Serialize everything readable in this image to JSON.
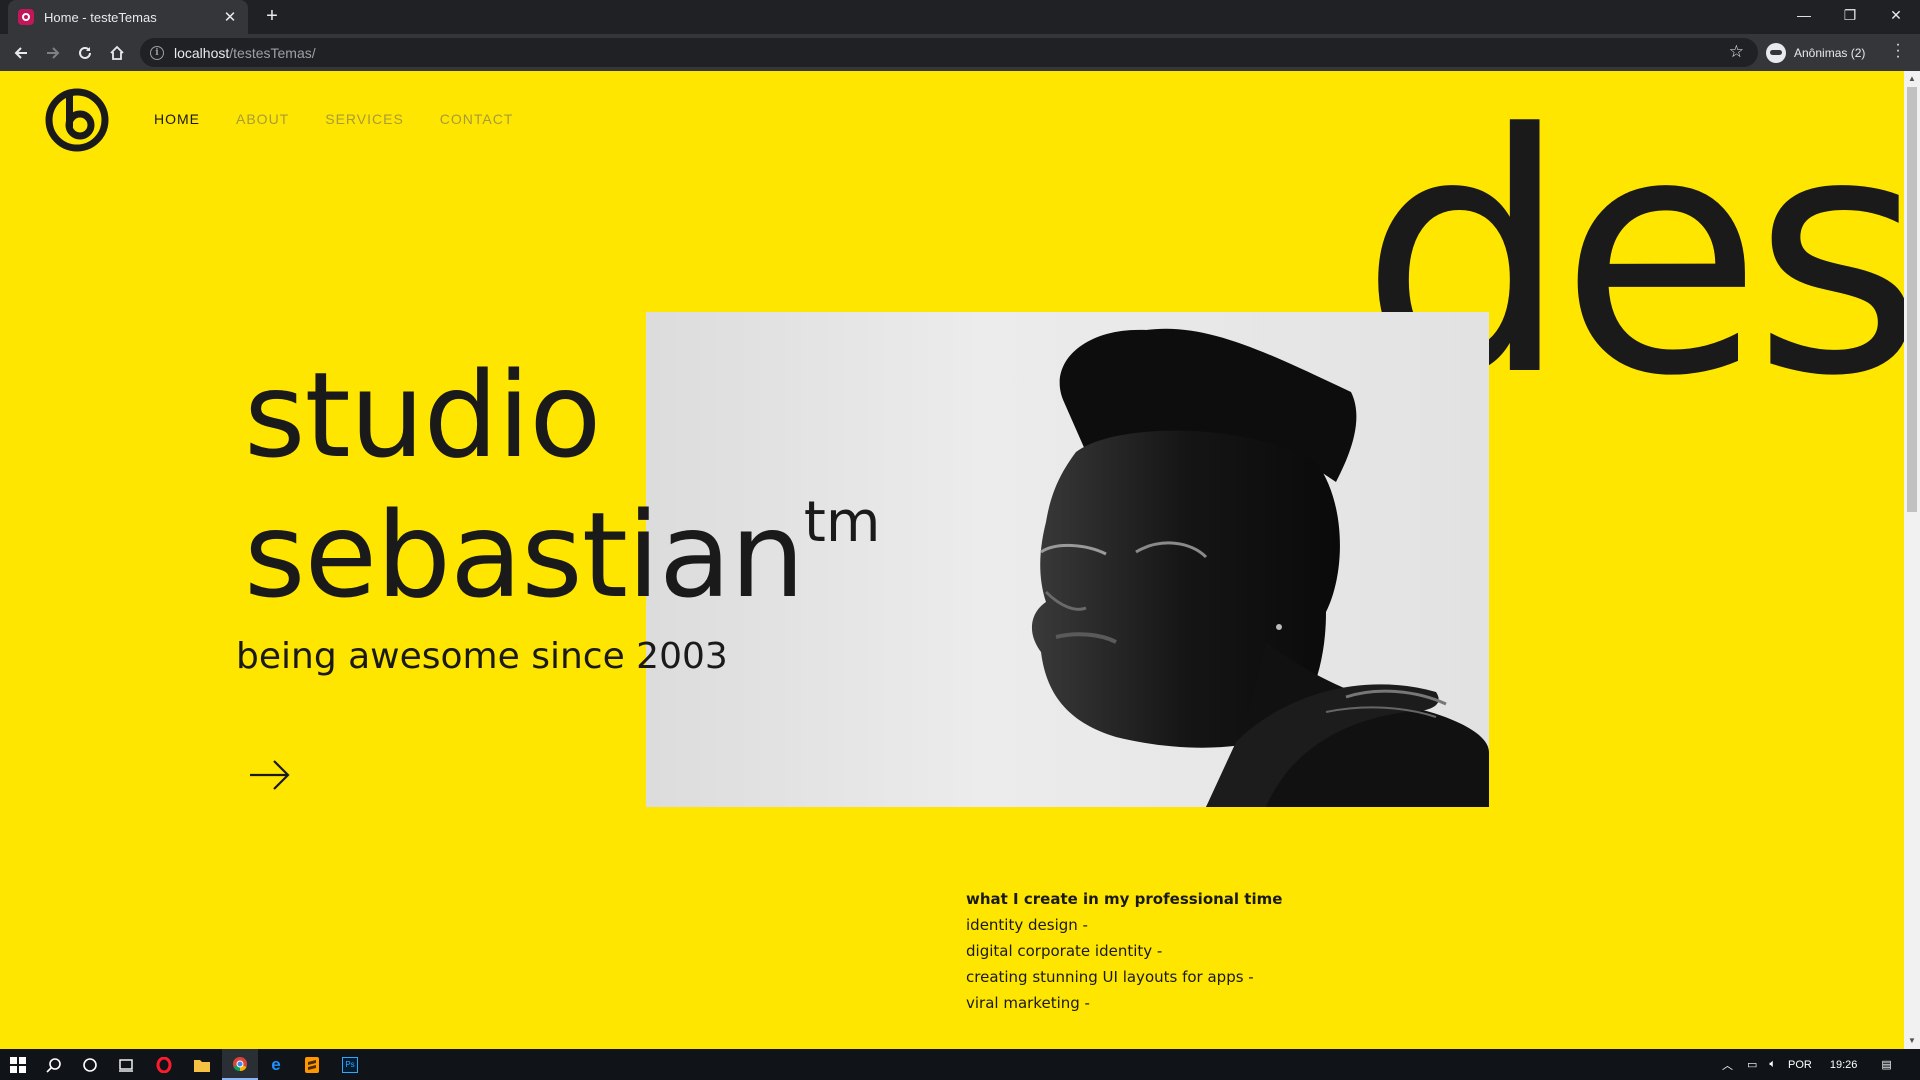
{
  "browser": {
    "tab_title": "Home - testeTemas",
    "url_host": "localhost",
    "url_path": "/testesTemas/",
    "profile_label": "Anônimas (2)"
  },
  "site": {
    "nav": [
      {
        "label": "HOME",
        "active": true
      },
      {
        "label": "ABOUT",
        "active": false
      },
      {
        "label": "SERVICES",
        "active": false
      },
      {
        "label": "CONTACT",
        "active": false
      }
    ],
    "background_word": "des",
    "headline_line1": "studio",
    "headline_line2": "sebastian",
    "headline_sup": "tm",
    "tagline": "being awesome since 2003",
    "services_title": "what I create in my professional time",
    "services": [
      "identity design -",
      "digital corporate identity -",
      "creating stunning UI layouts for apps -",
      "viral marketing -"
    ]
  },
  "taskbar": {
    "language": "POR",
    "time": "19:26"
  },
  "colors": {
    "page_background": "#ffe600",
    "text": "#1a1a1a",
    "nav_inactive": "#a69c3a"
  }
}
